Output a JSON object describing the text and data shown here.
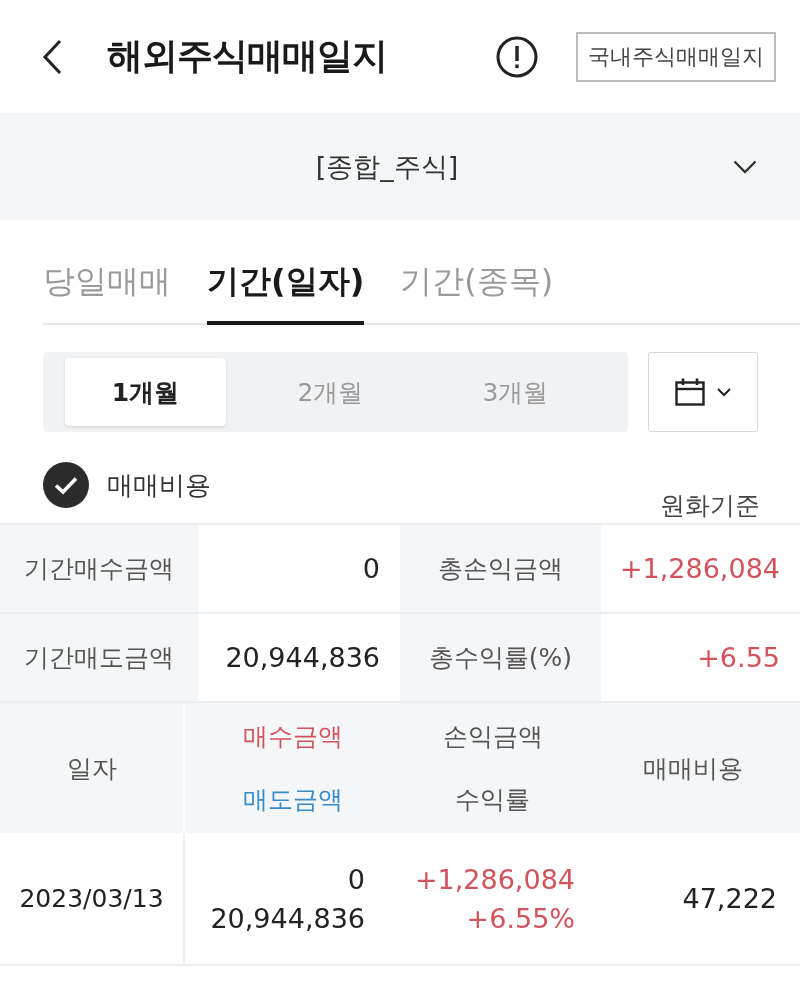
{
  "header": {
    "title": "해외주식매매일지",
    "switch_button": "국내주식매매일지"
  },
  "account_selector": {
    "value": "[종합_주식]"
  },
  "tabs": [
    {
      "label": "당일매매",
      "selected": false
    },
    {
      "label": "기간(일자)",
      "selected": true
    },
    {
      "label": "기간(종목)",
      "selected": false
    }
  ],
  "period_options": [
    {
      "label": "1개월",
      "selected": true
    },
    {
      "label": "2개월",
      "selected": false
    },
    {
      "label": "3개월",
      "selected": false
    }
  ],
  "fee_option": {
    "label": "매매비용",
    "checked": true
  },
  "currency_basis": "원화기준",
  "summary": [
    {
      "label": "기간매수금액",
      "value": "0",
      "color": "#222222"
    },
    {
      "label": "총손익금액",
      "value": "+1,286,084",
      "color": "#d1545c"
    },
    {
      "label": "기간매도금액",
      "value": "20,944,836",
      "color": "#222222"
    },
    {
      "label": "총수익률(%)",
      "value": "+6.55",
      "color": "#d1545c"
    }
  ],
  "table": {
    "columns": [
      {
        "lines": [
          {
            "text": "일자",
            "color": "#555555"
          }
        ]
      },
      {
        "lines": [
          {
            "text": "매수금액",
            "color": "#d1545c"
          },
          {
            "text": "매도금액",
            "color": "#3a8cc8"
          }
        ]
      },
      {
        "lines": [
          {
            "text": "손익금액",
            "color": "#555555"
          },
          {
            "text": "수익률",
            "color": "#555555"
          }
        ]
      },
      {
        "lines": [
          {
            "text": "매매비용",
            "color": "#555555"
          }
        ]
      }
    ],
    "rows": [
      {
        "cells": [
          {
            "lines": [
              {
                "text": "2023/03/13",
                "color": "#222222"
              }
            ]
          },
          {
            "lines": [
              {
                "text": "0",
                "color": "#222222"
              },
              {
                "text": "20,944,836",
                "color": "#222222"
              }
            ]
          },
          {
            "lines": [
              {
                "text": "+1,286,084",
                "color": "#d1545c"
              },
              {
                "text": "+6.55%",
                "color": "#d1545c"
              }
            ]
          },
          {
            "lines": [
              {
                "text": "47,222",
                "color": "#222222"
              }
            ]
          }
        ]
      }
    ]
  }
}
